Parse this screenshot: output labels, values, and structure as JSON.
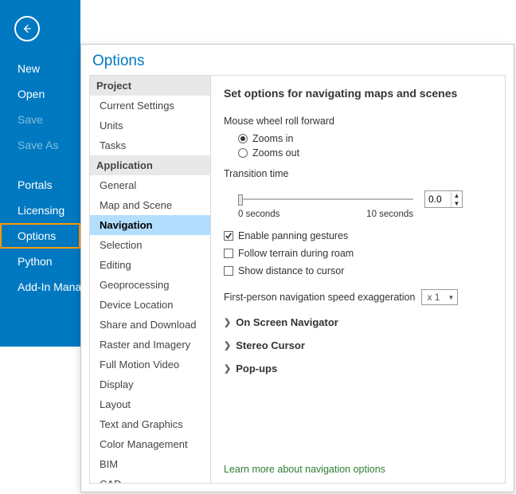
{
  "sidebar": {
    "items": [
      {
        "label": "New",
        "state": "normal"
      },
      {
        "label": "Open",
        "state": "normal"
      },
      {
        "label": "Save",
        "state": "disabled"
      },
      {
        "label": "Save As",
        "state": "disabled"
      },
      {
        "label": "Portals",
        "state": "normal"
      },
      {
        "label": "Licensing",
        "state": "normal"
      },
      {
        "label": "Options",
        "state": "selected"
      },
      {
        "label": "Python",
        "state": "normal"
      },
      {
        "label": "Add-In Manager",
        "state": "normal"
      }
    ]
  },
  "modal": {
    "title": "Options"
  },
  "categories": {
    "groups": [
      {
        "header": "Project",
        "items": [
          "Current Settings",
          "Units",
          "Tasks"
        ]
      },
      {
        "header": "Application",
        "items": [
          "General",
          "Map and Scene",
          "Navigation",
          "Selection",
          "Editing",
          "Geoprocessing",
          "Device Location",
          "Share and Download",
          "Raster and Imagery",
          "Full Motion Video",
          "Display",
          "Layout",
          "Text and Graphics",
          "Color Management",
          "BIM",
          "CAD"
        ]
      }
    ],
    "selected": "Navigation"
  },
  "main": {
    "heading": "Set options for navigating maps and scenes",
    "mouseWheelLabel": "Mouse wheel roll forward",
    "radios": {
      "zoomsIn": "Zooms in",
      "zoomsOut": "Zooms out"
    },
    "transitionLabel": "Transition time",
    "transitionValue": "0.0",
    "slider": {
      "minLabel": "0 seconds",
      "maxLabel": "10 seconds"
    },
    "checks": {
      "enablePanning": "Enable panning gestures",
      "followTerrain": "Follow terrain during roam",
      "showDistance": "Show distance to cursor"
    },
    "firstPersonLabel": "First-person navigation speed exaggeration",
    "firstPersonValue": "x 1",
    "expanders": {
      "onScreen": "On Screen Navigator",
      "stereo": "Stereo Cursor",
      "popups": "Pop-ups"
    },
    "learnMore": "Learn more about navigation options"
  }
}
